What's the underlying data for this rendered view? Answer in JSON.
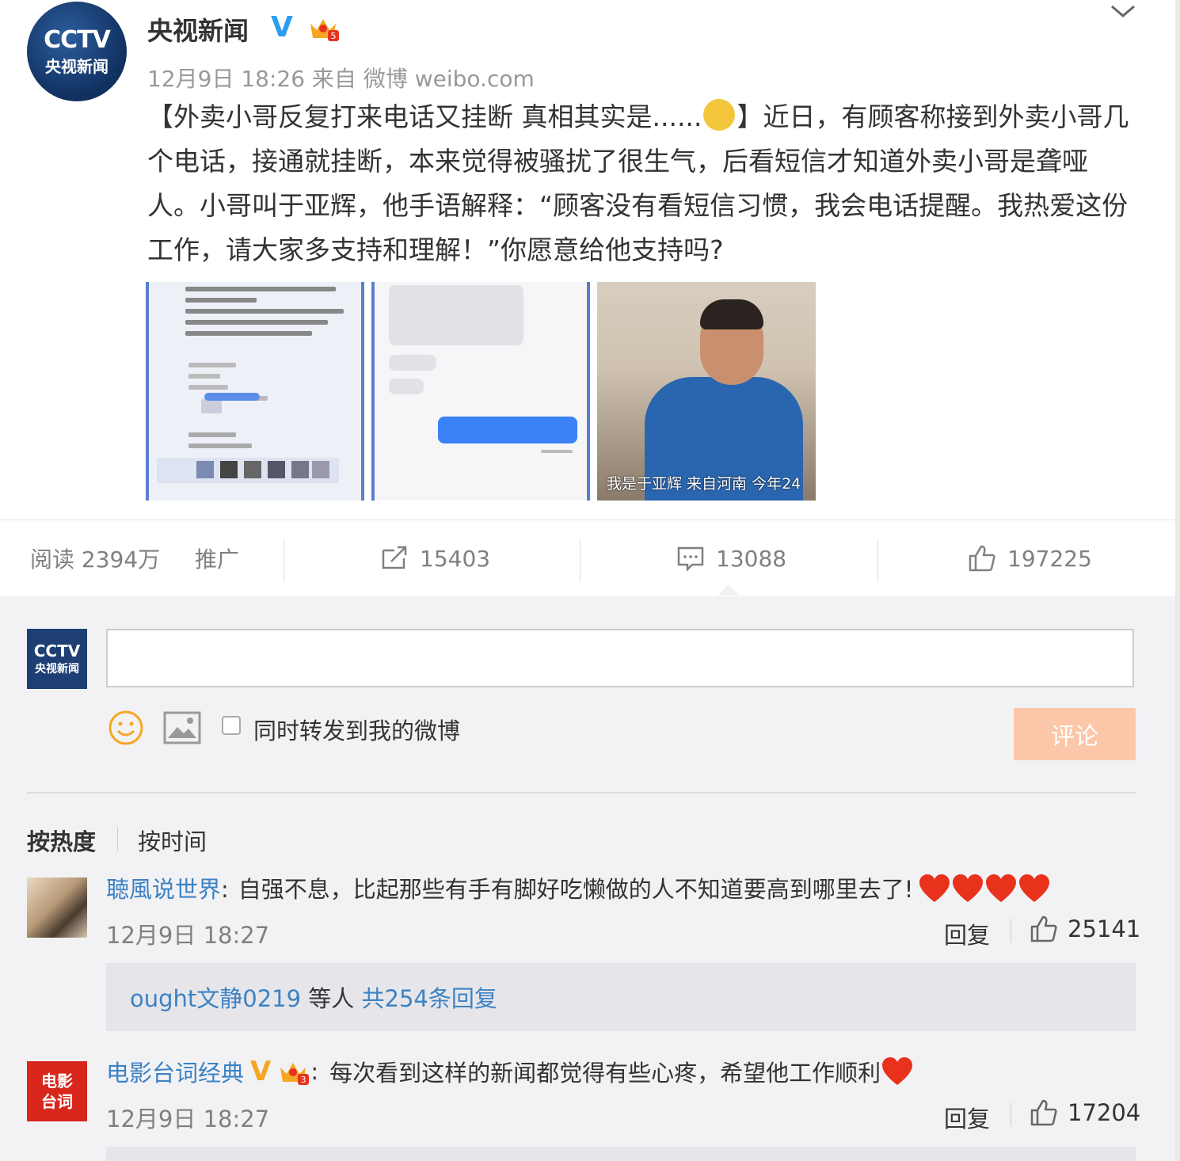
{
  "post": {
    "author": "央视新闻",
    "avatar_line1": "CCTV",
    "avatar_line2": "央视新闻",
    "meta": "12月9日 18:26 来自 微博 weibo.com",
    "text_part1": "【外卖小哥反复打来电话又挂断 真相其实是......",
    "text_part2": "】近日，有顾客称接到外卖小哥几个电话，接通就挂断，本来觉得被骚扰了很生气，后看短信才知道外卖小哥是聋哑人。小哥叫于亚辉，他手语解释：“顾客没有看短信习惯，我会电话提醒。我热爱这份工作，请大家多支持和理解！”你愿意给他支持吗?",
    "image3_caption": "我是于亚辉 来自河南 今年24"
  },
  "stats": {
    "read": "阅读 2394万",
    "promote": "推广",
    "forward": "15403",
    "comment": "13088",
    "like": "197225"
  },
  "composer": {
    "avatar_line1": "CCTV",
    "avatar_line2": "央视新闻",
    "forward_label": "同时转发到我的微博",
    "submit_label": "评论"
  },
  "sort": {
    "hot": "按热度",
    "time": "按时间"
  },
  "comments": [
    {
      "user": "聴風说世界",
      "colon": ":",
      "text": "自强不息，比起那些有手有脚好吃懒做的人不知道要高到哪里去了!",
      "time": "12月9日 18:27",
      "reply_label": "回复",
      "likes": "25141",
      "sub_user": "ought文静0219",
      "sub_mid": " 等人 ",
      "sub_total": "共254条回复"
    },
    {
      "user": "电影台词经典",
      "avatar_text1": "电影",
      "avatar_text2": "台词",
      "colon": ":",
      "text": "每次看到这样的新闻都觉得有些心疼，希望他工作顺利",
      "time": "12月9日 18:27",
      "reply_label": "回复",
      "likes": "17204"
    }
  ],
  "colors": {
    "link": "#3c82c4",
    "verified": "#2b9df0",
    "submit_disabled": "#fcc7a8",
    "heart": "#e8321c"
  }
}
